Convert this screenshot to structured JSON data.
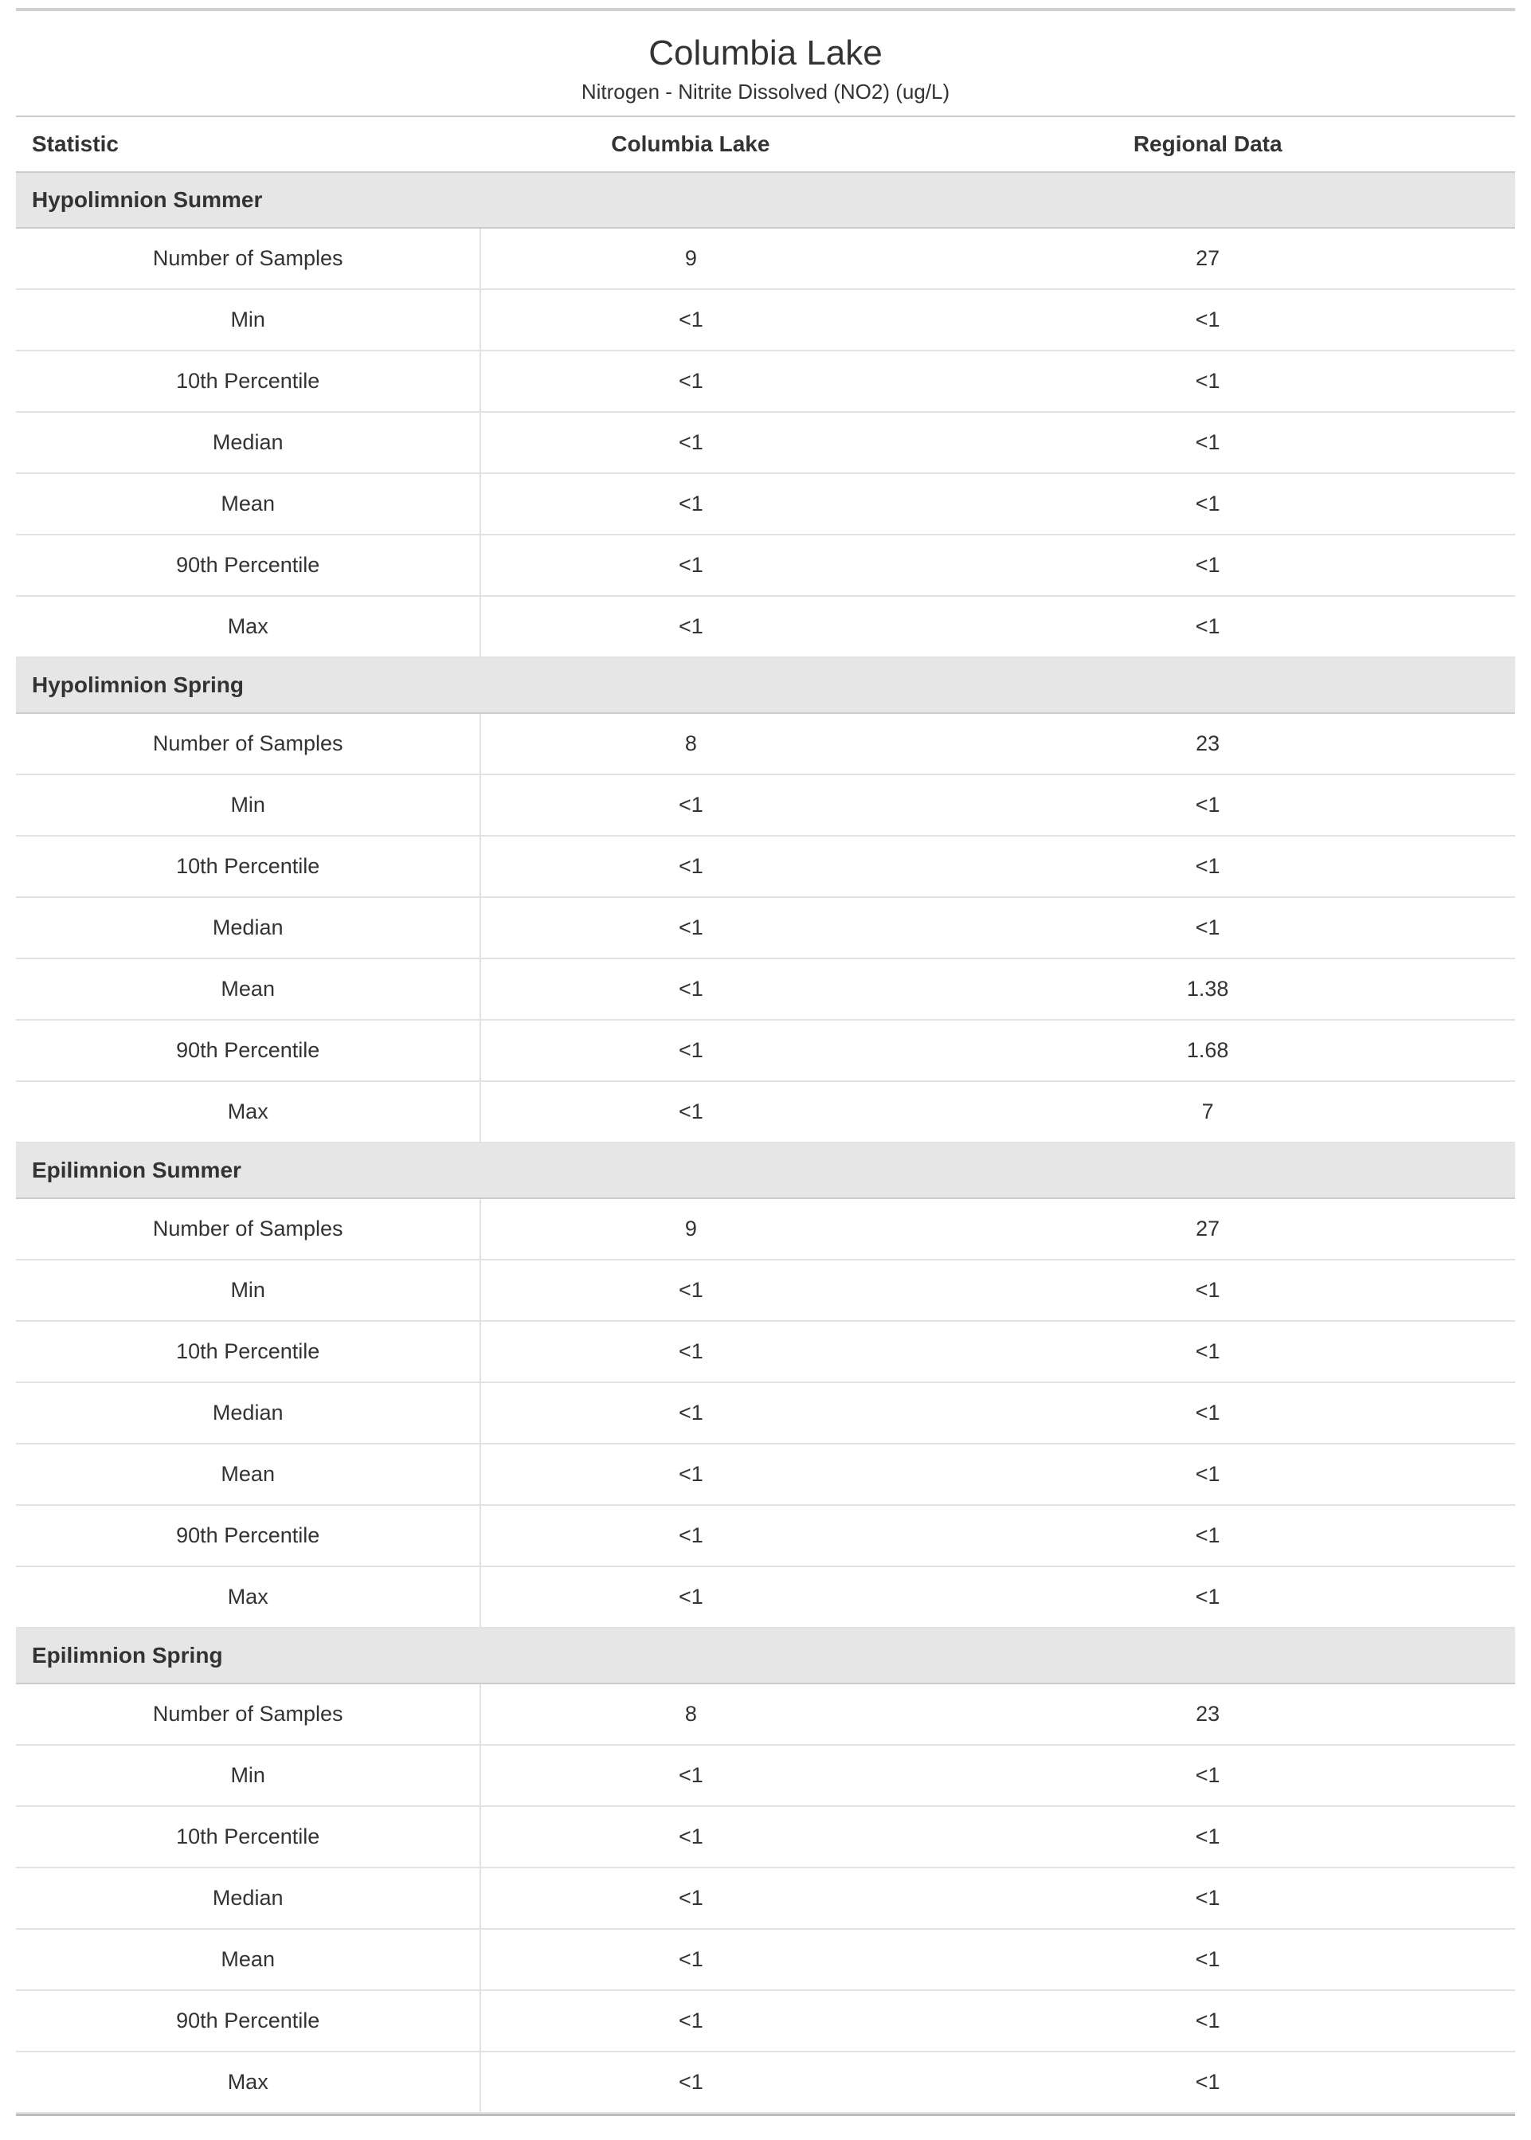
{
  "title": "Columbia Lake",
  "subtitle": "Nitrogen - Nitrite Dissolved (NO2) (ug/L)",
  "columns": {
    "stat": "Statistic",
    "local": "Columbia Lake",
    "regional": "Regional Data"
  },
  "sections": [
    {
      "name": "Hypolimnion Summer",
      "rows": [
        {
          "stat": "Number of Samples",
          "local": "9",
          "regional": "27"
        },
        {
          "stat": "Min",
          "local": "<1",
          "regional": "<1"
        },
        {
          "stat": "10th Percentile",
          "local": "<1",
          "regional": "<1"
        },
        {
          "stat": "Median",
          "local": "<1",
          "regional": "<1"
        },
        {
          "stat": "Mean",
          "local": "<1",
          "regional": "<1"
        },
        {
          "stat": "90th Percentile",
          "local": "<1",
          "regional": "<1"
        },
        {
          "stat": "Max",
          "local": "<1",
          "regional": "<1"
        }
      ]
    },
    {
      "name": "Hypolimnion Spring",
      "rows": [
        {
          "stat": "Number of Samples",
          "local": "8",
          "regional": "23"
        },
        {
          "stat": "Min",
          "local": "<1",
          "regional": "<1"
        },
        {
          "stat": "10th Percentile",
          "local": "<1",
          "regional": "<1"
        },
        {
          "stat": "Median",
          "local": "<1",
          "regional": "<1"
        },
        {
          "stat": "Mean",
          "local": "<1",
          "regional": "1.38"
        },
        {
          "stat": "90th Percentile",
          "local": "<1",
          "regional": "1.68"
        },
        {
          "stat": "Max",
          "local": "<1",
          "regional": "7"
        }
      ]
    },
    {
      "name": "Epilimnion Summer",
      "rows": [
        {
          "stat": "Number of Samples",
          "local": "9",
          "regional": "27"
        },
        {
          "stat": "Min",
          "local": "<1",
          "regional": "<1"
        },
        {
          "stat": "10th Percentile",
          "local": "<1",
          "regional": "<1"
        },
        {
          "stat": "Median",
          "local": "<1",
          "regional": "<1"
        },
        {
          "stat": "Mean",
          "local": "<1",
          "regional": "<1"
        },
        {
          "stat": "90th Percentile",
          "local": "<1",
          "regional": "<1"
        },
        {
          "stat": "Max",
          "local": "<1",
          "regional": "<1"
        }
      ]
    },
    {
      "name": "Epilimnion Spring",
      "rows": [
        {
          "stat": "Number of Samples",
          "local": "8",
          "regional": "23"
        },
        {
          "stat": "Min",
          "local": "<1",
          "regional": "<1"
        },
        {
          "stat": "10th Percentile",
          "local": "<1",
          "regional": "<1"
        },
        {
          "stat": "Median",
          "local": "<1",
          "regional": "<1"
        },
        {
          "stat": "Mean",
          "local": "<1",
          "regional": "<1"
        },
        {
          "stat": "90th Percentile",
          "local": "<1",
          "regional": "<1"
        },
        {
          "stat": "Max",
          "local": "<1",
          "regional": "<1"
        }
      ]
    }
  ]
}
